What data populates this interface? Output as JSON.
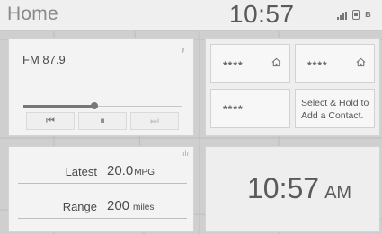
{
  "header": {
    "title": "Home",
    "clock": "10:57"
  },
  "icons": {
    "signal": "signal-icon",
    "phone": "phone-icon",
    "bluetooth": "bluetooth-icon",
    "bluetooth_glyph": "ʙ"
  },
  "audio": {
    "station": "FM  87.9",
    "progress": 0.45,
    "note_glyph": "♪",
    "controls": {
      "prev_glyph": "⏮",
      "pause_glyph": "⏸",
      "next_glyph": "⏭"
    }
  },
  "contacts": {
    "slots": [
      {
        "label": "****",
        "home": true
      },
      {
        "label": "****",
        "home": true
      },
      {
        "label": "****",
        "home": false
      }
    ],
    "hint_line1": "Select & Hold to",
    "hint_line2": "Add a Contact."
  },
  "eco": {
    "latest_label": "Latest",
    "latest_value": "20.0",
    "latest_unit": "MPG",
    "range_label": "Range",
    "range_value": "200",
    "range_unit": "miles",
    "icon_glyph": "ılı"
  },
  "clock_widget": {
    "time": "10:57",
    "ampm": "AM"
  }
}
